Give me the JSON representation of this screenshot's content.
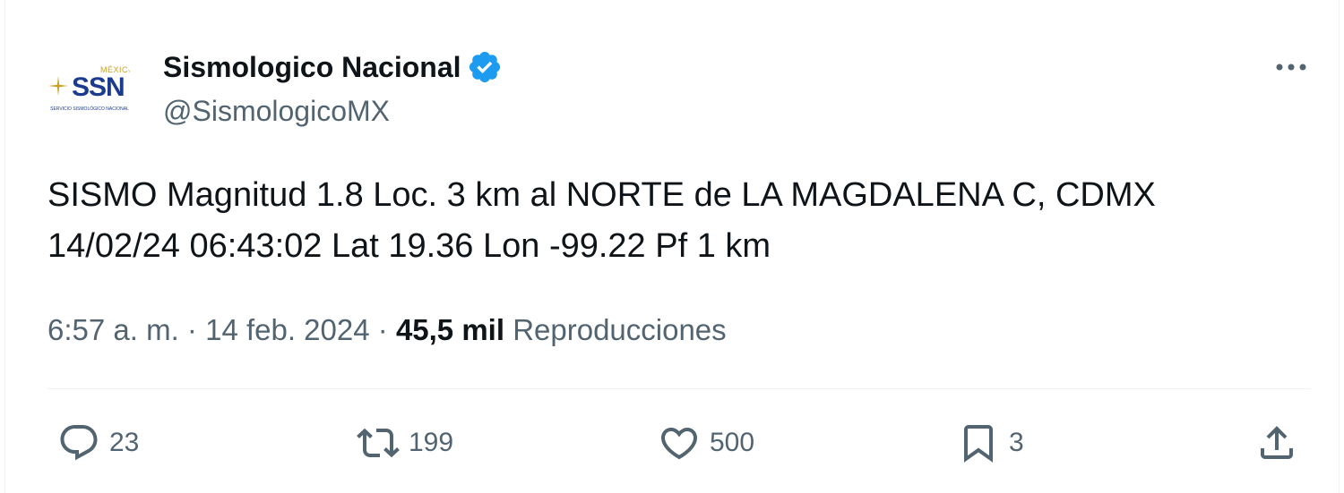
{
  "author": {
    "name": "Sismologico Nacional",
    "handle": "@SismologicoMX",
    "avatar": {
      "mexico": "MÉXICO",
      "initials": "SSN",
      "subtitle": "SERVICIO SISMOLÓGICO NACIONAL"
    },
    "verified_color": "#1d9bf0"
  },
  "tweet": {
    "line1": "SISMO Magnitud 1.8 Loc. 3 km al NORTE de LA MAGDALENA C, CDMX",
    "line2": "14/02/24 06:43:02 Lat 19.36 Lon -99.22 Pf 1 km"
  },
  "meta": {
    "time": "6:57 a. m.",
    "separator": "·",
    "date": "14 feb. 2024",
    "views_count": "45,5 mil",
    "views_label": "Reproducciones"
  },
  "actions": {
    "replies": "23",
    "retweets": "199",
    "likes": "500",
    "bookmarks": "3"
  },
  "icons": [
    "verified-badge-icon",
    "more-icon",
    "reply-icon",
    "retweet-icon",
    "like-icon",
    "bookmark-icon",
    "share-icon"
  ],
  "colors": {
    "text": "#0f1419",
    "secondary": "#536471",
    "divider": "#eff3f4",
    "brand_blue": "#1c3b8c",
    "brand_gold": "#c9a227"
  }
}
